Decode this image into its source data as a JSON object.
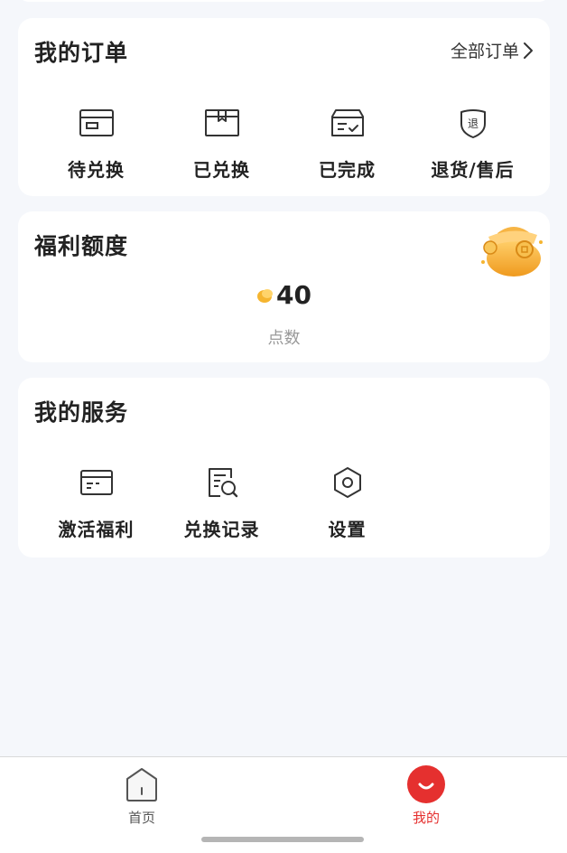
{
  "orders": {
    "title": "我的订单",
    "all_link": "全部订单",
    "items": [
      {
        "label": "待兑换",
        "icon": "card-icon"
      },
      {
        "label": "已兑换",
        "icon": "package-icon"
      },
      {
        "label": "已完成",
        "icon": "box-check-icon"
      },
      {
        "label": "退货/售后",
        "icon": "return-shield-icon"
      }
    ],
    "return_glyph": "退"
  },
  "benefits": {
    "title": "福利额度",
    "points_value": "40",
    "points_unit": "点数",
    "decoration_icon": "lucky-bag-icon"
  },
  "services": {
    "title": "我的服务",
    "items": [
      {
        "label": "激活福利",
        "icon": "activate-card-icon"
      },
      {
        "label": "兑换记录",
        "icon": "record-search-icon"
      },
      {
        "label": "设置",
        "icon": "settings-hex-icon"
      }
    ]
  },
  "tabbar": {
    "tabs": [
      {
        "label": "首页",
        "icon": "home-icon",
        "active": false
      },
      {
        "label": "我的",
        "icon": "profile-smile-icon",
        "active": true
      }
    ]
  },
  "colors": {
    "accent": "#e5302f",
    "background": "#f5f7fb",
    "coin": "#f5b530"
  }
}
